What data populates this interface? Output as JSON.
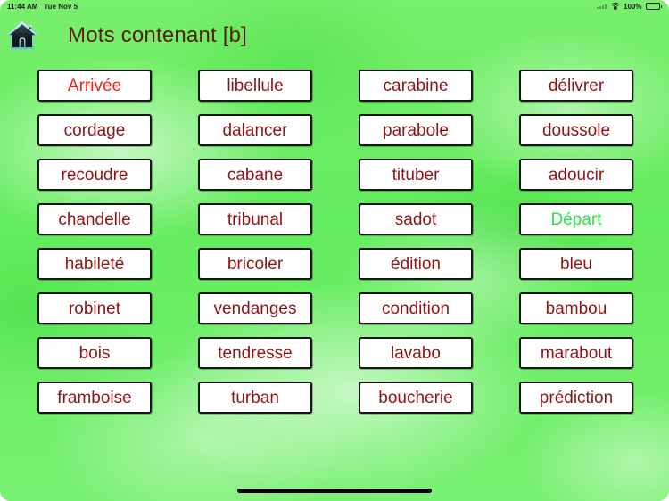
{
  "status_bar": {
    "time": "11:44 AM",
    "date": "Tue Nov 5",
    "battery_percent": "100%",
    "wifi_icon": "wifi-icon",
    "battery_icon": "battery-icon",
    "signal_icon": "signal-dots-icon"
  },
  "header": {
    "home_icon": "home-icon",
    "title": "Mots contenant [b]"
  },
  "colors": {
    "background_green": "#6ef06a",
    "card_background": "#ffffff",
    "card_border": "#161616",
    "word_default": "#8f1515",
    "word_highlight_red": "#f41d1d",
    "word_highlight_green": "#2ae04a",
    "title": "#5a1d0d"
  },
  "grid": {
    "columns": 4,
    "rows": 8,
    "words": [
      {
        "text": "Arrivée",
        "color": "red",
        "column": 1,
        "row": 1
      },
      {
        "text": "libellule",
        "color": "default",
        "column": 2,
        "row": 1
      },
      {
        "text": "carabine",
        "color": "default",
        "column": 3,
        "row": 1
      },
      {
        "text": "délivrer",
        "color": "default",
        "column": 4,
        "row": 1
      },
      {
        "text": "cordage",
        "color": "default",
        "column": 1,
        "row": 2
      },
      {
        "text": "dalancer",
        "color": "default",
        "column": 2,
        "row": 2
      },
      {
        "text": "parabole",
        "color": "default",
        "column": 3,
        "row": 2
      },
      {
        "text": "doussole",
        "color": "default",
        "column": 4,
        "row": 2
      },
      {
        "text": "recoudre",
        "color": "default",
        "column": 1,
        "row": 3
      },
      {
        "text": "cabane",
        "color": "default",
        "column": 2,
        "row": 3
      },
      {
        "text": "tituber",
        "color": "default",
        "column": 3,
        "row": 3
      },
      {
        "text": "adoucir",
        "color": "default",
        "column": 4,
        "row": 3
      },
      {
        "text": "chandelle",
        "color": "default",
        "column": 1,
        "row": 4
      },
      {
        "text": "tribunal",
        "color": "default",
        "column": 2,
        "row": 4
      },
      {
        "text": "sadot",
        "color": "default",
        "column": 3,
        "row": 4
      },
      {
        "text": "Départ",
        "color": "green",
        "column": 4,
        "row": 4
      },
      {
        "text": "habileté",
        "color": "default",
        "column": 1,
        "row": 5
      },
      {
        "text": "bricoler",
        "color": "default",
        "column": 2,
        "row": 5
      },
      {
        "text": "édition",
        "color": "default",
        "column": 3,
        "row": 5
      },
      {
        "text": "bleu",
        "color": "default",
        "column": 4,
        "row": 5
      },
      {
        "text": "robinet",
        "color": "default",
        "column": 1,
        "row": 6
      },
      {
        "text": "vendanges",
        "color": "default",
        "column": 2,
        "row": 6
      },
      {
        "text": "condition",
        "color": "default",
        "column": 3,
        "row": 6
      },
      {
        "text": "bambou",
        "color": "default",
        "column": 4,
        "row": 6
      },
      {
        "text": "bois",
        "color": "default",
        "column": 1,
        "row": 7
      },
      {
        "text": "tendresse",
        "color": "default",
        "column": 2,
        "row": 7
      },
      {
        "text": "lavabo",
        "color": "default",
        "column": 3,
        "row": 7
      },
      {
        "text": "marabout",
        "color": "default",
        "column": 4,
        "row": 7
      },
      {
        "text": "framboise",
        "color": "default",
        "column": 1,
        "row": 8
      },
      {
        "text": "turban",
        "color": "default",
        "column": 2,
        "row": 8
      },
      {
        "text": "boucherie",
        "color": "default",
        "column": 3,
        "row": 8
      },
      {
        "text": "prédiction",
        "color": "default",
        "column": 4,
        "row": 8
      }
    ]
  },
  "home_indicator": "home-indicator"
}
